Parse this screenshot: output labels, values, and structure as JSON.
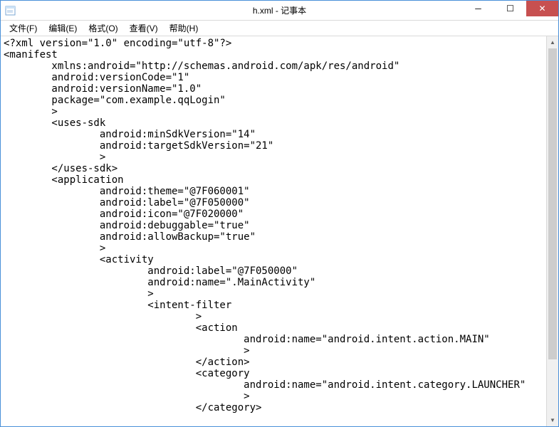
{
  "window": {
    "title": "h.xml - 记事本"
  },
  "menu": {
    "file": "文件(F)",
    "edit": "编辑(E)",
    "format": "格式(O)",
    "view": "查看(V)",
    "help": "帮助(H)"
  },
  "controls": {
    "minimize": "─",
    "maximize": "☐",
    "close": "✕"
  },
  "scrollbar": {
    "up": "▲",
    "down": "▼"
  },
  "editor": {
    "content": "<?xml version=\"1.0\" encoding=\"utf-8\"?>\n<manifest\n        xmlns:android=\"http://schemas.android.com/apk/res/android\"\n        android:versionCode=\"1\"\n        android:versionName=\"1.0\"\n        package=\"com.example.qqLogin\"\n        >\n        <uses-sdk\n                android:minSdkVersion=\"14\"\n                android:targetSdkVersion=\"21\"\n                >\n        </uses-sdk>\n        <application\n                android:theme=\"@7F060001\"\n                android:label=\"@7F050000\"\n                android:icon=\"@7F020000\"\n                android:debuggable=\"true\"\n                android:allowBackup=\"true\"\n                >\n                <activity\n                        android:label=\"@7F050000\"\n                        android:name=\".MainActivity\"\n                        >\n                        <intent-filter\n                                >\n                                <action\n                                        android:name=\"android.intent.action.MAIN\"\n                                        >\n                                </action>\n                                <category\n                                        android:name=\"android.intent.category.LAUNCHER\"\n                                        >\n                                </category>"
  }
}
